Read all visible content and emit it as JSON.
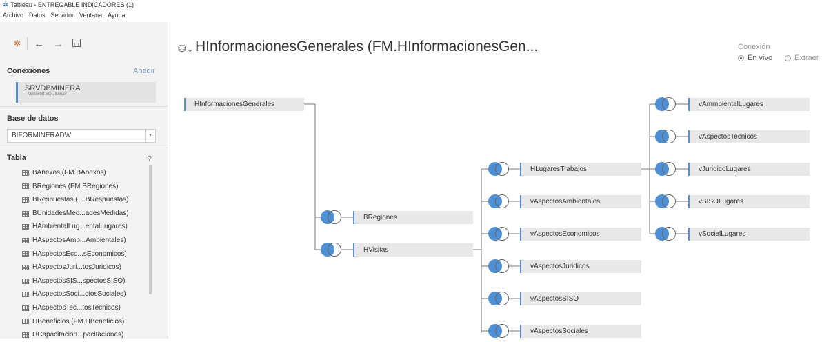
{
  "window": {
    "title": "Tableau - ENTREGABLE INDICADORES (1)"
  },
  "menu": [
    "Archivo",
    "Datos",
    "Servidor",
    "Ventana",
    "Ayuda"
  ],
  "sidebar": {
    "connections_title": "Conexiones",
    "add_label": "Añadir",
    "connection": {
      "name": "SRVDBMINERA",
      "type": "Microsoft SQL Server"
    },
    "database_title": "Base de datos",
    "database_value": "BIFORMINERADW",
    "table_title": "Tabla",
    "tables": [
      "BAnexos (FM.BAnexos)",
      "BRegiones (FM.BRegiones)",
      "BRespuestas (....BRespuestas)",
      "BUnidadesMed...adesMedidas)",
      "HAmbientalLug...entalLugares)",
      "HAspectosAmb...Ambientales)",
      "HAspectosEco...sEconomicos)",
      "HAspectosJuri...tosJuridicos)",
      "HAspectosSIS...spectosSISO)",
      "HAspectosSoci...ctosSociales)",
      "HAspectosTec...tosTecnicos)",
      "HBeneficios (FM.HBeneficios)",
      "HCapacitacion...pacitaciones)"
    ]
  },
  "datasource": {
    "title": "HInformacionesGenerales (FM.HInformacionesGen...",
    "connection_label": "Conexión",
    "live_label": "En vivo",
    "extract_label": "Extraer",
    "selected": "En vivo"
  },
  "diagram": {
    "root": "HInformacionesGenerales",
    "level1": [
      "BRegiones",
      "HVisitas"
    ],
    "level2": [
      "HLugaresTrabajos",
      "vAspectosAmbientales",
      "vAspectosEconomicos",
      "vAspectosJuridicos",
      "vAspectosSISO",
      "vAspectosSociales"
    ],
    "level3": [
      "vAmmbientalLugares",
      "vAspectosTecnicos",
      "vJuridicoLugares",
      "vSISOLugares",
      "vSocialLugares"
    ]
  },
  "colors": {
    "accent": "#4f8fd4",
    "node_bg": "#e8e8e8",
    "sidebar_bg": "#f3f3f3",
    "logo": "#d3702d"
  },
  "icons": [
    "tableau-logo-icon",
    "back-arrow-icon",
    "forward-arrow-icon",
    "save-icon",
    "search-icon",
    "table-icon",
    "datasource-cylinder-icon",
    "join-icon"
  ]
}
